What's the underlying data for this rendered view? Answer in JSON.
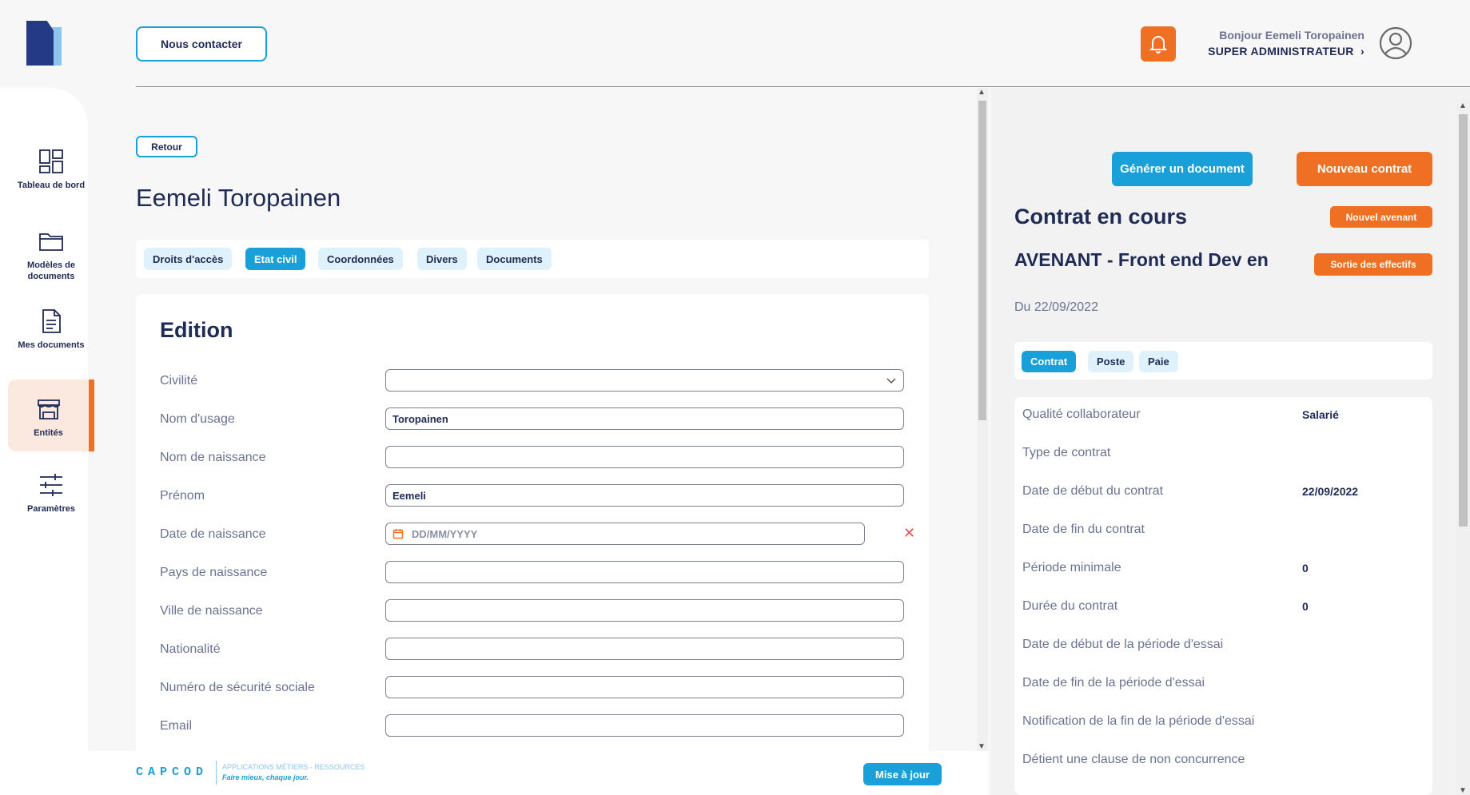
{
  "header": {
    "contact_label": "Nous contacter",
    "greeting": "Bonjour Eemeli Toropainen",
    "role": "SUPER ADMINISTRATEUR",
    "role_chevron": "›"
  },
  "sidebar": {
    "items": [
      {
        "label": "Tableau de bord",
        "icon": "dashboard-icon"
      },
      {
        "label": "Modèles de documents",
        "icon": "folder-icon"
      },
      {
        "label": "Mes documents",
        "icon": "document-icon"
      },
      {
        "label": "Entités",
        "icon": "store-icon",
        "active": true
      },
      {
        "label": "Paramètres",
        "icon": "sliders-icon"
      }
    ]
  },
  "main": {
    "back_label": "Retour",
    "person_name": "Eemeli Toropainen",
    "tabs": [
      {
        "label": "Droits d'accès"
      },
      {
        "label": "Etat civil",
        "active": true
      },
      {
        "label": "Coordonnées"
      },
      {
        "label": "Divers"
      },
      {
        "label": "Documents"
      }
    ],
    "edition": {
      "title": "Edition",
      "fields": [
        {
          "label": "Civilité",
          "value": "",
          "type": "select"
        },
        {
          "label": "Nom d'usage",
          "value": "Toropainen"
        },
        {
          "label": "Nom de naissance",
          "value": ""
        },
        {
          "label": "Prénom",
          "value": "Eemeli"
        },
        {
          "label": "Date de naissance",
          "value": "",
          "placeholder": "DD/MM/YYYY",
          "type": "date"
        },
        {
          "label": "Pays de naissance",
          "value": ""
        },
        {
          "label": "Ville de naissance",
          "value": ""
        },
        {
          "label": "Nationalité",
          "value": ""
        },
        {
          "label": "Numéro de sécurité sociale",
          "value": ""
        },
        {
          "label": "Email",
          "value": ""
        }
      ]
    }
  },
  "footer": {
    "brand": "CAPCOD",
    "tagline_top": "APPLICATIONS MÉTIERS - RESSOURCES",
    "tagline_bottom": "Faire mieux, chaque jour.",
    "update_label": "Mise à jour"
  },
  "right": {
    "generate_label": "Générer un document",
    "new_contract_label": "Nouveau contrat",
    "contract_title": "Contrat en cours",
    "new_amendment_label": "Nouvel avenant",
    "amendment_title": "AVENANT - Front end Dev en",
    "exit_label": "Sortie des effectifs",
    "date_from": "Du 22/09/2022",
    "tabs": [
      {
        "label": "Contrat",
        "active": true
      },
      {
        "label": "Poste"
      },
      {
        "label": "Paie"
      }
    ],
    "details": [
      {
        "label": "Qualité collaborateur",
        "value": "Salarié"
      },
      {
        "label": "Type de contrat",
        "value": ""
      },
      {
        "label": "Date de début du contrat",
        "value": "22/09/2022"
      },
      {
        "label": "Date de fin du contrat",
        "value": ""
      },
      {
        "label": "Période minimale",
        "value": "0"
      },
      {
        "label": "Durée du contrat",
        "value": "0"
      },
      {
        "label": "Date de début de la période d'essai",
        "value": ""
      },
      {
        "label": "Date de fin de la période d'essai",
        "value": ""
      },
      {
        "label": "Notification de la fin de la période d'essai",
        "value": ""
      },
      {
        "label": "Détient une clause de non concurrence",
        "value": ""
      }
    ]
  },
  "colors": {
    "accent_blue": "#1aa0d8",
    "accent_orange": "#f07023",
    "navy": "#1f2a55"
  }
}
